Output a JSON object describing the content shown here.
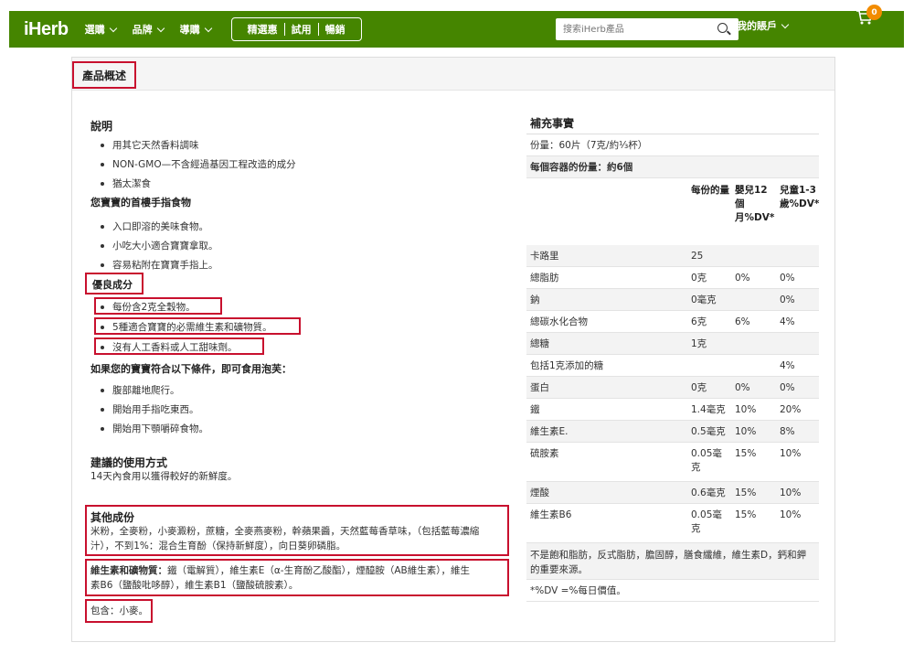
{
  "header": {
    "logo": "iHerb",
    "nav": [
      "選購",
      "品牌",
      "導購"
    ],
    "promo": [
      "精選惠",
      "試用",
      "暢銷"
    ],
    "search_placeholder": "搜索iHerb產品",
    "account": "我的賬戶",
    "cart_count": "0"
  },
  "overview": {
    "title": "產品概述"
  },
  "description": {
    "title": "說明",
    "items": [
      "用其它天然香料調味",
      "NON-GMO—不含經過基因工程改造的成分",
      "猶太潔食"
    ],
    "first_finger_food": "您寶寶的首樓手指食物",
    "finger_items": [
      "入口即溶的美味食物。",
      "小吃大小適合寶寶拿取。",
      "容易粘附在寶寶手指上。"
    ],
    "good_title": "優良成分",
    "good_items": [
      "每份含2克全穀物。",
      "5種適合寶寶的必需維生素和礦物質。",
      "沒有人工香料或人工甜味劑。"
    ],
    "if_title": "如果您的寶寶符合以下條件，即可食用泡芙：",
    "if_items": [
      "腹部離地爬行。",
      "開始用手指吃東西。",
      "開始用下顎嚼碎食物。"
    ]
  },
  "usage": {
    "title": "建議的使用方式",
    "text": "14天內食用以獲得較好的新鮮度。"
  },
  "other": {
    "title": "其他成份",
    "line1": "米粉，全麥粉，小麥澱粉，蔗糖，全麥燕麥粉，幹蘋果醬，天然藍莓香草味，（包括藍莓濃縮",
    "line2": "汁），不到1%：混合生育酚（保持新鮮度），向日葵卵磷脂。",
    "vit_label": "維生素和礦物質：",
    "vit_line1": "鐵（電解質），維生素E（α-生育酚乙酸酯），煙醯胺（AB維生素），維生",
    "vit_line2": "素B6（鹽酸吡哆醇），維生素B1（鹽酸硫胺素）。",
    "contains": "包含：小麥。"
  },
  "facts": {
    "title": "補充事實",
    "serving": "份量：60片（7克/約⅓杯）",
    "per_container": "每個容器的份量：約6個",
    "col_headers": [
      "每份的量",
      "嬰兒12個月%DV*",
      "兒童1-3歲%DV*"
    ],
    "rows": [
      {
        "name": "卡路里",
        "amount": "25",
        "infant": "",
        "child": ""
      },
      {
        "name": "總脂肪",
        "amount": "0克",
        "infant": "0%",
        "child": "0%"
      },
      {
        "name": "鈉",
        "amount": "0毫克",
        "infant": "",
        "child": "0%"
      },
      {
        "name": "總碳水化合物",
        "amount": "6克",
        "infant": "6%",
        "child": "4%"
      },
      {
        "name": "總糖",
        "amount": "1克",
        "infant": "",
        "child": ""
      },
      {
        "name": "包括1克添加的糖",
        "amount": "",
        "infant": "",
        "child": "4%"
      },
      {
        "name": "蛋白",
        "amount": "0克",
        "infant": "0%",
        "child": "0%"
      },
      {
        "name": "鐵",
        "amount": "1.4毫克",
        "infant": "10%",
        "child": "20%"
      },
      {
        "name": "維生素E.",
        "amount": "0.5毫克",
        "infant": "10%",
        "child": "8%"
      },
      {
        "name": "硫胺素",
        "amount": "0.05毫克",
        "infant": "15%",
        "child": "10%"
      },
      {
        "name": "煙酸",
        "amount": "0.6毫克",
        "infant": "15%",
        "child": "10%"
      },
      {
        "name": "維生素B6",
        "amount": "0.05毫克",
        "infant": "15%",
        "child": "10%"
      }
    ],
    "footnote1": "不是飽和脂肪，反式脂肪，膽固醇，膳食纖維，維生素D，鈣和鉀的重要來源。",
    "footnote2": "*%DV =%每日價值。"
  }
}
